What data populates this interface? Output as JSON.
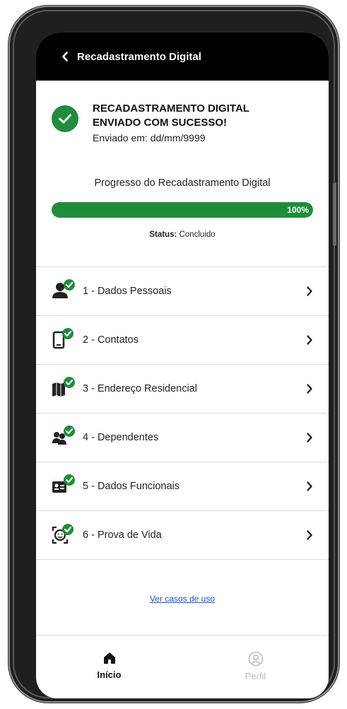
{
  "header": {
    "title": "Recadastramento Digital",
    "back_icon": "chevron-left-icon"
  },
  "success": {
    "icon": "check-circle-icon",
    "title_line1": "RECADASTRAMENTO DIGITAL",
    "title_line2": "ENVIADO COM SUCESSO!",
    "sent_date": "Enviado em: dd/mm/9999"
  },
  "progress": {
    "label": "Progresso do Recadastramento Digital",
    "value": 100,
    "value_text": "100%",
    "color": "#1f8d3b"
  },
  "status": {
    "label": "Status:",
    "value": "Concluido"
  },
  "menu": {
    "items": [
      {
        "label": "1 - Dados Pessoais",
        "icon": "person-check-icon"
      },
      {
        "label": "2 - Contatos",
        "icon": "phone-check-icon"
      },
      {
        "label": "3 - Endereço Residencial",
        "icon": "map-check-icon"
      },
      {
        "label": "4 - Dependentes",
        "icon": "people-check-icon"
      },
      {
        "label": "5 - Dados Funcionais",
        "icon": "id-card-check-icon"
      },
      {
        "label": "6 - Prova de Vida",
        "icon": "face-scan-check-icon"
      }
    ]
  },
  "link": {
    "label": "Ver casos de uso"
  },
  "bottom_nav": {
    "items": [
      {
        "label": "Início",
        "icon": "home-icon",
        "active": true
      },
      {
        "label": "Perfil",
        "icon": "profile-icon",
        "active": false
      }
    ]
  }
}
